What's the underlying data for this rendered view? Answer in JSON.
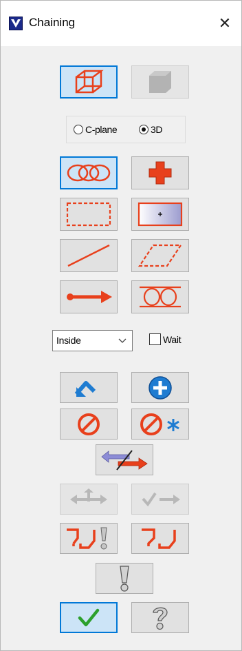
{
  "window": {
    "title": "Chaining",
    "close_glyph": "✕"
  },
  "mode": {
    "options": [
      "C-plane",
      "3D"
    ],
    "selected": "3D"
  },
  "containment": {
    "selected_value": "Inside",
    "wait_label": "Wait",
    "wait_checked": false
  },
  "icons": {
    "wireframe": "wireframe-cube-icon",
    "solid": "solid-cube-icon",
    "chain": "chain-links-icon",
    "point": "point-cross-icon",
    "window": "window-select-icon",
    "area": "area-point-icon",
    "vector": "vector-line-icon",
    "polygon": "polygon-select-icon",
    "single": "single-arrow-icon",
    "partial": "partial-chain-icon",
    "end": "end-chain-icon",
    "add": "add-icon",
    "unselect": "unselect-icon",
    "unselect_all": "unselect-all-icon",
    "reverse": "reverse-direction-icon",
    "move_start": "move-start-icon",
    "accept_end": "accept-end-icon",
    "sync_warn": "sync-warning-icon",
    "sync": "sync-icon",
    "info": "info-exclamation-icon",
    "ok": "ok-checkmark-icon",
    "help": "help-question-icon"
  },
  "colors": {
    "accent_red": "#e8401c",
    "select_blue": "#0078d7",
    "icon_blue": "#1f7cd1",
    "ok_green": "#2ca02c"
  }
}
